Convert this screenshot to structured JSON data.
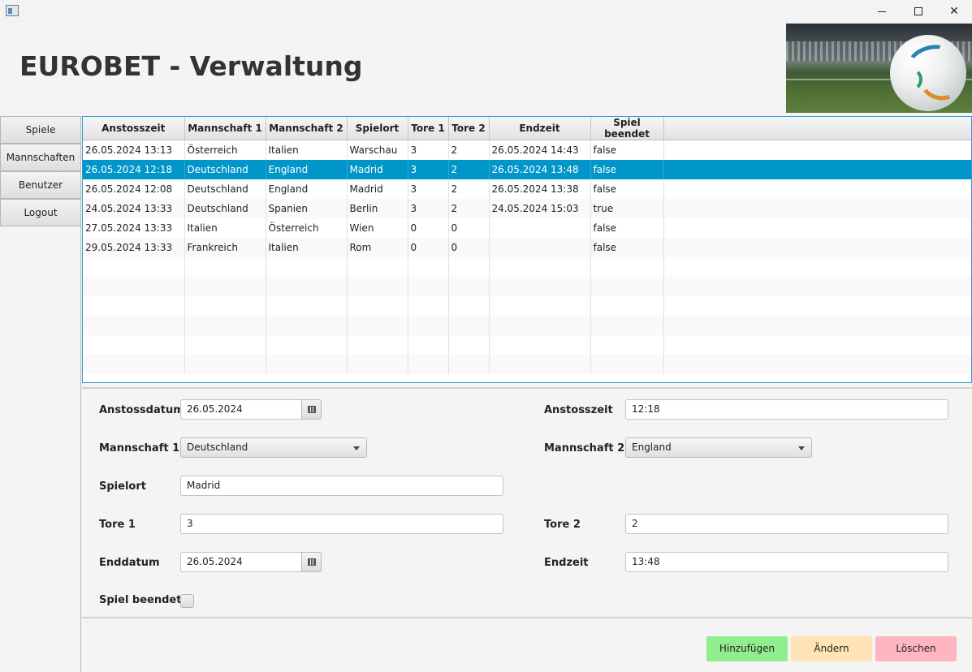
{
  "window": {
    "minimize": "—",
    "maximize": "☐",
    "close": "✕"
  },
  "header": {
    "title": "EUROBET - Verwaltung"
  },
  "sidebar": {
    "items": [
      {
        "label": "Spiele"
      },
      {
        "label": "Mannschaften"
      },
      {
        "label": "Benutzer"
      },
      {
        "label": "Logout"
      }
    ]
  },
  "table": {
    "columns": [
      "Anstosszeit",
      "Mannschaft 1",
      "Mannschaft 2",
      "Spielort",
      "Tore 1",
      "Tore 2",
      "Endzeit",
      "Spiel beendet"
    ],
    "rows": [
      [
        "26.05.2024 13:13",
        "Österreich",
        "Italien",
        "Warschau",
        "3",
        "2",
        "26.05.2024 14:43",
        "false"
      ],
      [
        "26.05.2024 12:18",
        "Deutschland",
        "England",
        "Madrid",
        "3",
        "2",
        "26.05.2024 13:48",
        "false"
      ],
      [
        "26.05.2024 12:08",
        "Deutschland",
        "England",
        "Madrid",
        "3",
        "2",
        "26.05.2024 13:38",
        "false"
      ],
      [
        "24.05.2024 13:33",
        "Deutschland",
        "Spanien",
        "Berlin",
        "3",
        "2",
        "24.05.2024 15:03",
        "true"
      ],
      [
        "27.05.2024 13:33",
        "Italien",
        "Österreich",
        "Wien",
        "0",
        "0",
        "",
        "false"
      ],
      [
        "29.05.2024 13:33",
        "Frankreich",
        "Italien",
        "Rom",
        "0",
        "0",
        "",
        "false"
      ]
    ],
    "selected_row": 1
  },
  "form": {
    "anstossdatum_label": "Anstossdatum",
    "anstossdatum_value": "26.05.2024",
    "anstosszeit_label": "Anstosszeit",
    "anstosszeit_value": "12:18",
    "mannschaft1_label": "Mannschaft 1",
    "mannschaft1_value": "Deutschland",
    "mannschaft2_label": "Mannschaft 2",
    "mannschaft2_value": "England",
    "spielort_label": "Spielort",
    "spielort_value": "Madrid",
    "tore1_label": "Tore 1",
    "tore1_value": "3",
    "tore2_label": "Tore 2",
    "tore2_value": "2",
    "enddatum_label": "Enddatum",
    "enddatum_value": "26.05.2024",
    "endzeit_label": "Endzeit",
    "endzeit_value": "13:48",
    "spiel_beendet_label": "Spiel beendet",
    "spiel_beendet_checked": false
  },
  "actions": {
    "add": "Hinzufügen",
    "edit": "Ändern",
    "delete": "Löschen"
  },
  "colors": {
    "selection": "#0096c9",
    "add": "#90ee90",
    "edit": "#ffe4b5",
    "delete": "#ffb6c1"
  }
}
